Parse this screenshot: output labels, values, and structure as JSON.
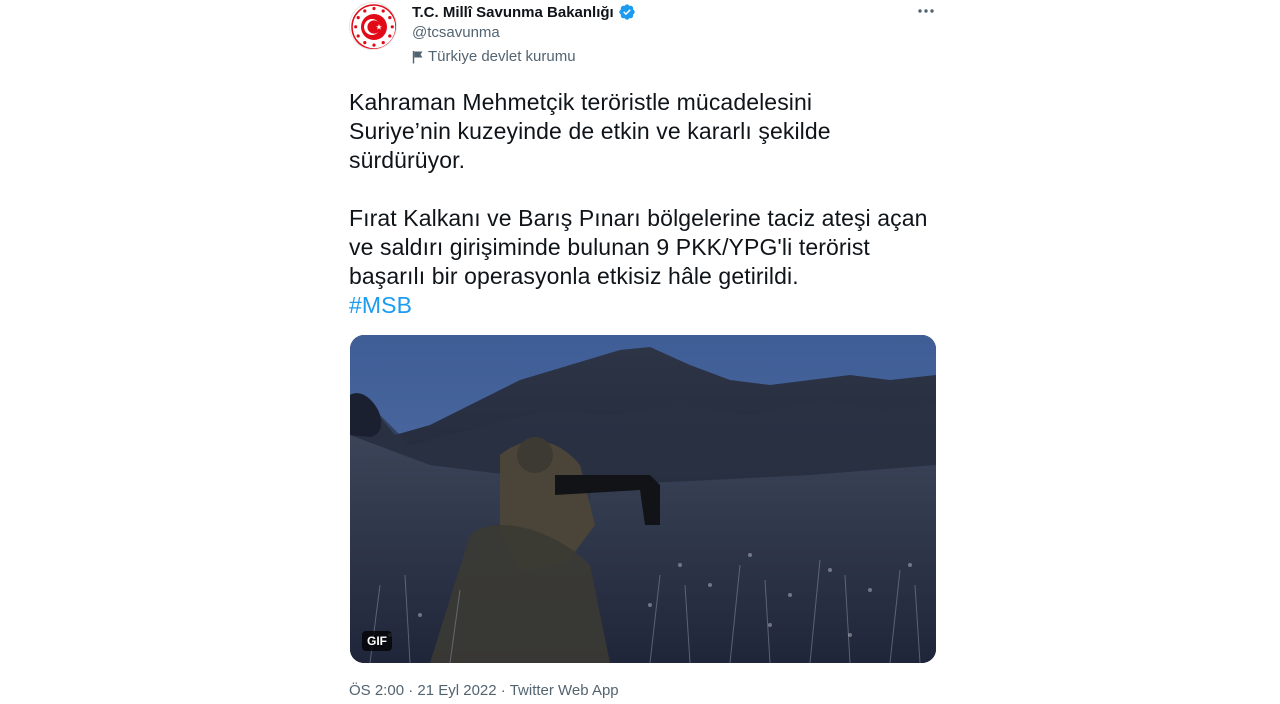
{
  "account": {
    "display_name": "T.C. Millî Savunma Bakanlığı",
    "handle": "@tcsavunma",
    "label": "Türkiye devlet kurumu",
    "verified_color": "#1d9bf0"
  },
  "tweet": {
    "paragraph1_line1": "Kahraman Mehmetçik teröristle mücadelesini",
    "paragraph1_line2": "Suriye’nin kuzeyinde de etkin ve kararlı şekilde",
    "paragraph1_line3": "sürdürüyor.",
    "paragraph2_line1": "Fırat Kalkanı ve Barış Pınarı bölgelerine taciz ateşi açan",
    "paragraph2_line2": "ve saldırı girişiminde bulunan 9 PKK/YPG'li terörist",
    "paragraph2_line3": "başarılı bir operasyonla etkisiz hâle getirildi.",
    "hashtag": "#MSB",
    "media_badge": "GIF"
  },
  "meta": {
    "time": "ÖS 2:00",
    "separator": "·",
    "date": "21 Eyl 2022",
    "source": "Twitter Web App"
  },
  "icons": {
    "more": "more-horizontal-icon",
    "verified": "verified-badge-icon",
    "flag": "flag-icon"
  },
  "colors": {
    "text_primary": "#0f1419",
    "text_secondary": "#536471",
    "accent": "#1d9bf0",
    "logo_red": "#e30a17"
  }
}
